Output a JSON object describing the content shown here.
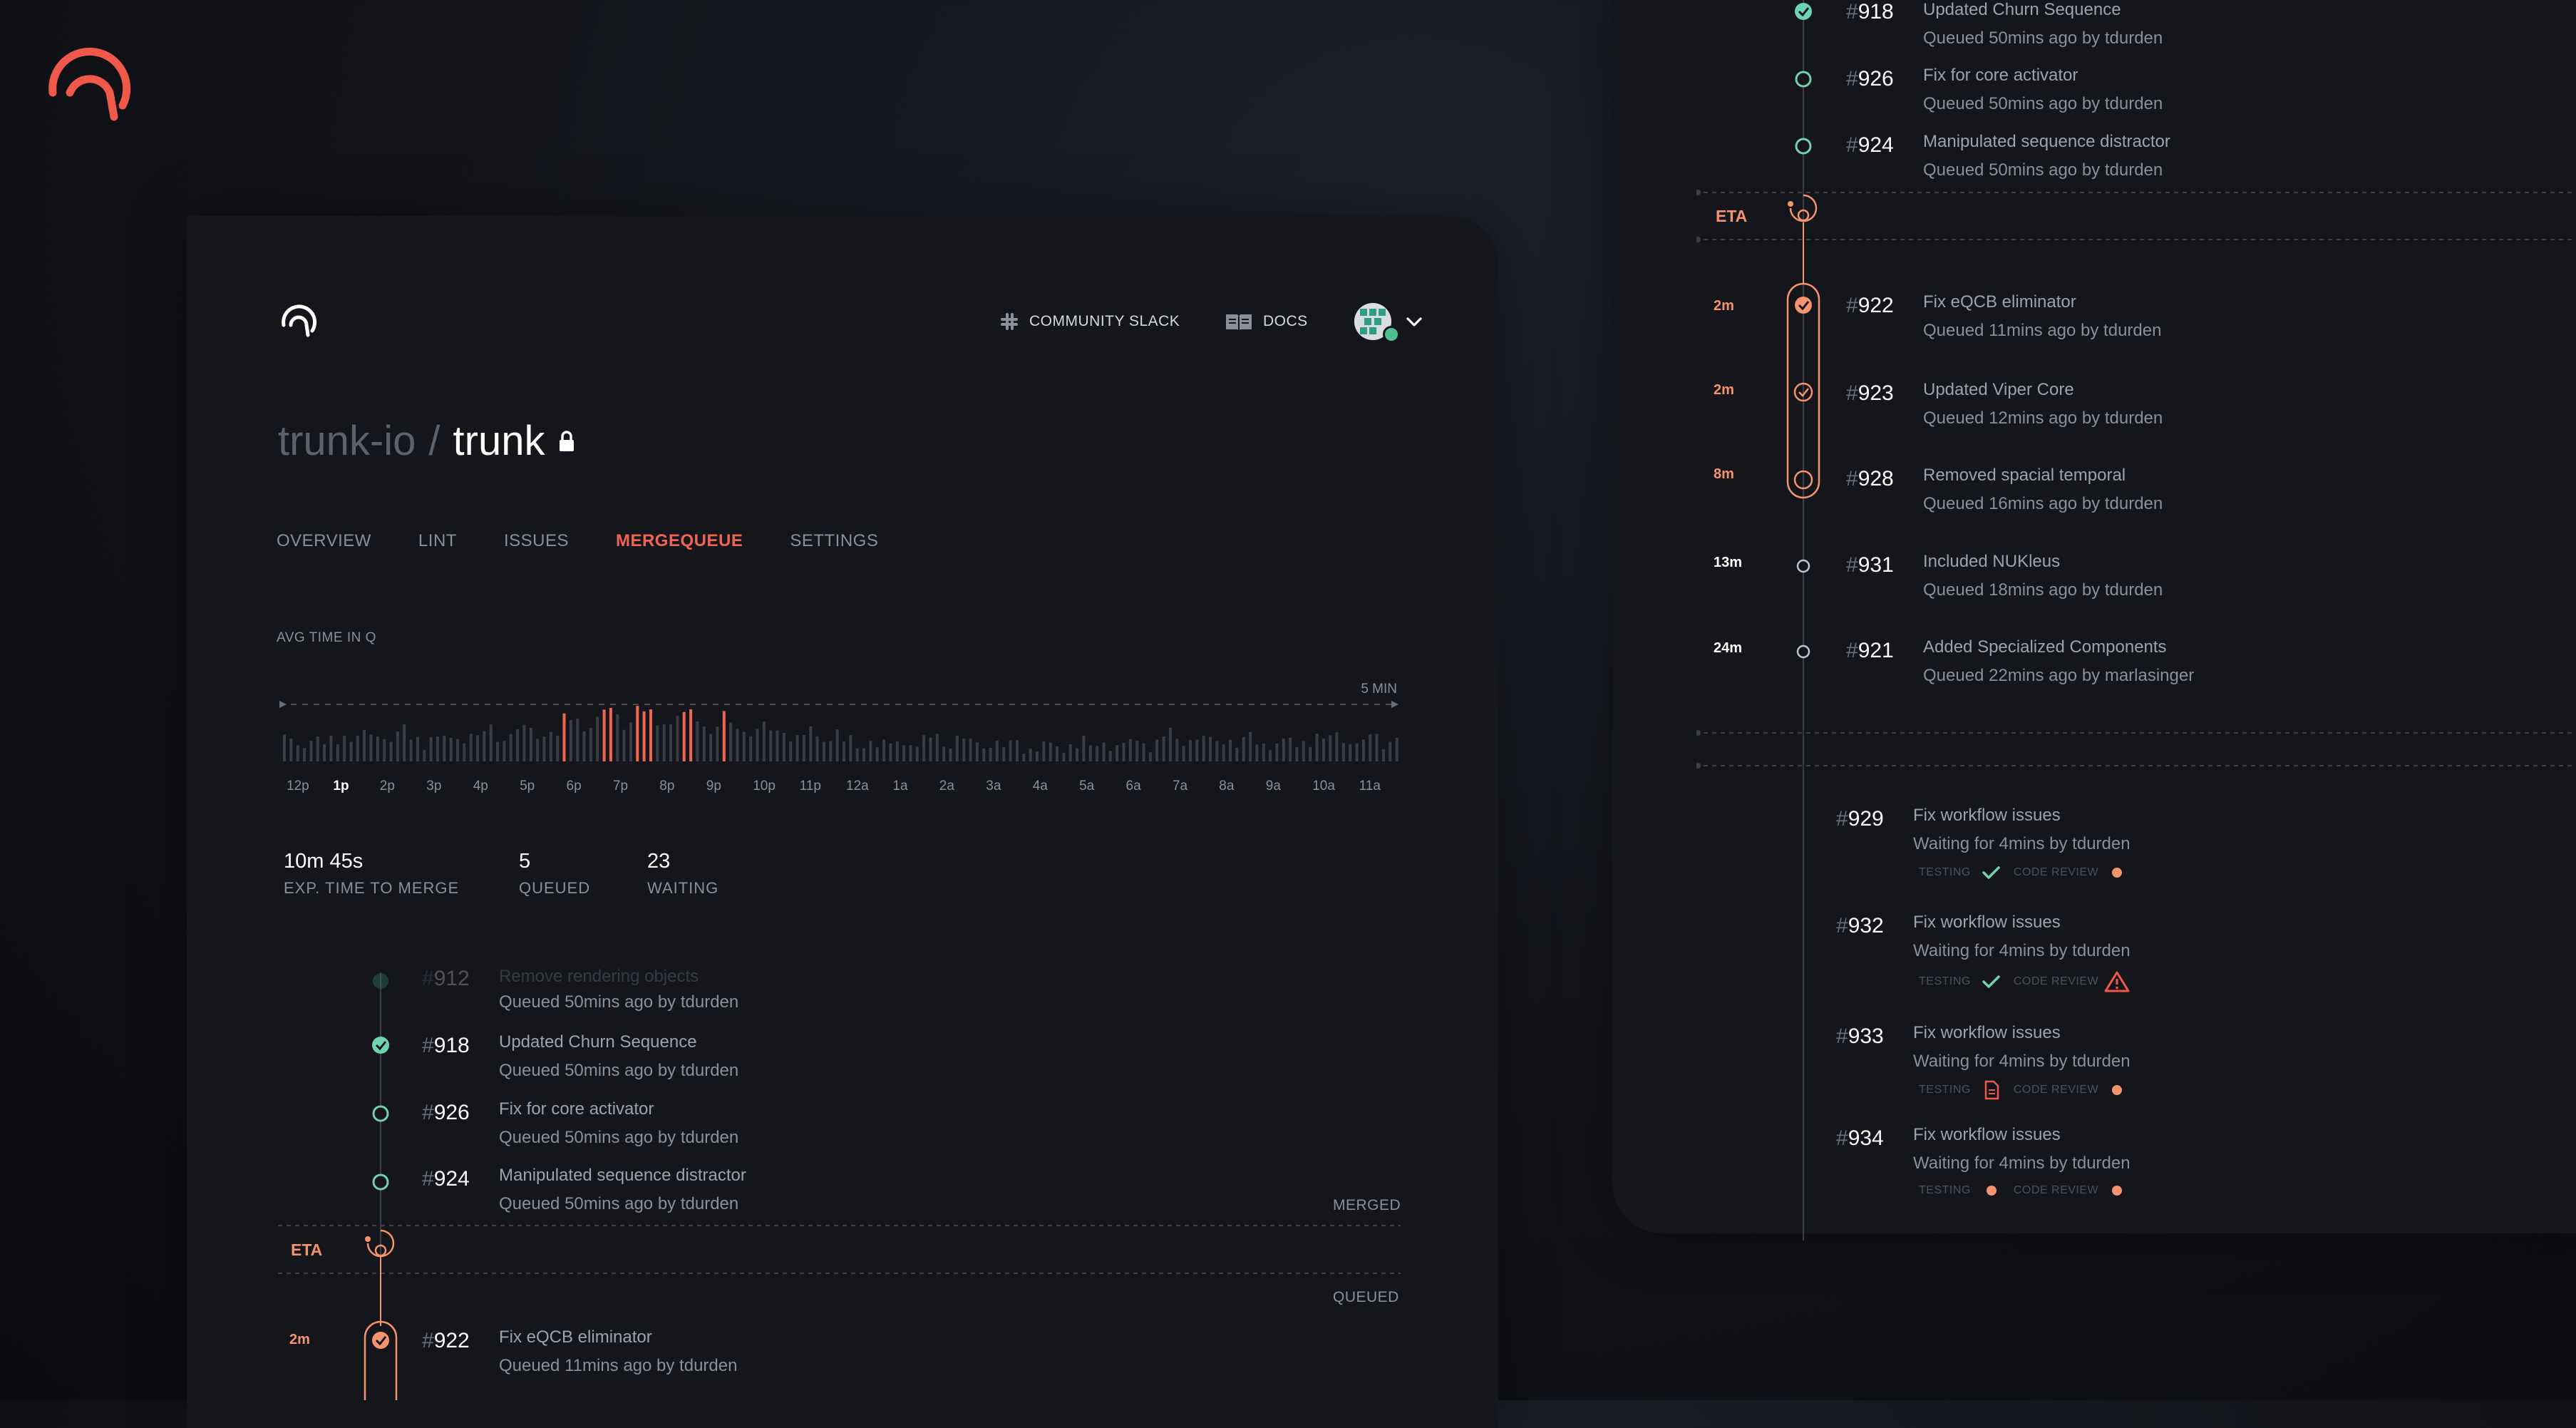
{
  "header": {
    "community_slack": "COMMUNITY SLACK",
    "docs": "DOCS"
  },
  "repo": {
    "org": "trunk-io",
    "separator": "/",
    "name": "trunk"
  },
  "tabs": [
    "OVERVIEW",
    "LINT",
    "ISSUES",
    "MERGEQUEUE",
    "SETTINGS"
  ],
  "active_tab": "MERGEQUEUE",
  "chart_data": {
    "type": "bar",
    "title": "AVG TIME IN Q",
    "threshold_label": "5 MIN",
    "categories": [
      "12p",
      "1p",
      "2p",
      "3p",
      "4p",
      "5p",
      "6p",
      "7p",
      "8p",
      "9p",
      "10p",
      "11p",
      "12a",
      "1a",
      "2a",
      "3a",
      "4a",
      "5a",
      "6a",
      "7a",
      "8a",
      "9a",
      "10a",
      "11a"
    ],
    "highlighted_tick": "1p",
    "values": [
      2.1,
      2.6,
      2.8,
      2.4,
      2.9,
      3.1,
      4.3,
      4.9,
      4.6,
      3.9,
      3.3,
      2.8,
      1.9,
      2.0,
      2.2,
      1.8,
      1.6,
      1.8,
      2.0,
      2.4,
      2.2,
      2.0,
      2.5,
      2.3
    ],
    "accent_color": "#f06452",
    "bar_color": "#3a3d46"
  },
  "stats": [
    {
      "value": "10m 45s",
      "label": "EXP. TIME TO MERGE"
    },
    {
      "value": "5",
      "label": "QUEUED"
    },
    {
      "value": "23",
      "label": "WAITING"
    }
  ],
  "left_queue": {
    "faded_item": {
      "num": "912",
      "title": "Remove rendering objects",
      "sub": "Queued 50mins ago by tdurden"
    },
    "merged": [
      {
        "num": "918",
        "title": "Updated Churn Sequence",
        "sub": "Queued 50mins ago by tdurden"
      },
      {
        "num": "926",
        "title": "Fix for core activator",
        "sub": "Queued 50mins ago by tdurden"
      },
      {
        "num": "924",
        "title": "Manipulated sequence distractor",
        "sub": "Queued 50mins ago by tdurden"
      }
    ],
    "merged_label": "MERGED",
    "eta_label": "ETA",
    "queued_label": "QUEUED",
    "queued": [
      {
        "dur": "2m",
        "num": "922",
        "title": "Fix eQCB eliminator",
        "sub": "Queued 11mins ago by tdurden"
      }
    ]
  },
  "right_queue": {
    "merged": [
      {
        "num": "918",
        "title": "Updated Churn Sequence",
        "sub": "Queued 50mins ago by tdurden"
      },
      {
        "num": "926",
        "title": "Fix for core activator",
        "sub": "Queued 50mins ago by tdurden"
      },
      {
        "num": "924",
        "title": "Manipulated sequence distractor",
        "sub": "Queued 50mins ago by tdurden"
      }
    ],
    "eta_label": "ETA",
    "queued": [
      {
        "dur": "2m",
        "num": "922",
        "title": "Fix eQCB eliminator",
        "sub": "Queued 11mins ago by tdurden"
      },
      {
        "dur": "2m",
        "num": "923",
        "title": "Updated Viper Core",
        "sub": "Queued 12mins ago by tdurden"
      },
      {
        "dur": "8m",
        "num": "928",
        "title": "Removed spacial temporal",
        "sub": "Queued 16mins ago by tdurden"
      },
      {
        "dur": "13m",
        "num": "931",
        "title": "Included NUKleus",
        "sub": "Queued 18mins ago by tdurden"
      },
      {
        "dur": "24m",
        "num": "921",
        "title": "Added Specialized Components",
        "sub": "Queued 22mins ago by marlasinger"
      }
    ],
    "waiting": [
      {
        "num": "929",
        "title": "Fix workflow issues",
        "sub": "Waiting for 4mins by tdurden",
        "testing": "TESTING",
        "code_review": "CODE REVIEW"
      },
      {
        "num": "932",
        "title": "Fix workflow issues",
        "sub": "Waiting for 4mins by tdurden",
        "testing": "TESTING",
        "code_review": "CODE REVIEW"
      },
      {
        "num": "933",
        "title": "Fix workflow issues",
        "sub": "Waiting for 4mins by tdurden",
        "testing": "TESTING",
        "code_review": "CODE REVIEW"
      },
      {
        "num": "934",
        "title": "Fix workflow issues",
        "sub": "Waiting for 4mins by tdurden",
        "testing": "TESTING",
        "code_review": "CODE REVIEW"
      }
    ]
  },
  "colors": {
    "accent": "#f06452",
    "eta": "#f4946c",
    "merged_green": "#6fd3b0"
  }
}
